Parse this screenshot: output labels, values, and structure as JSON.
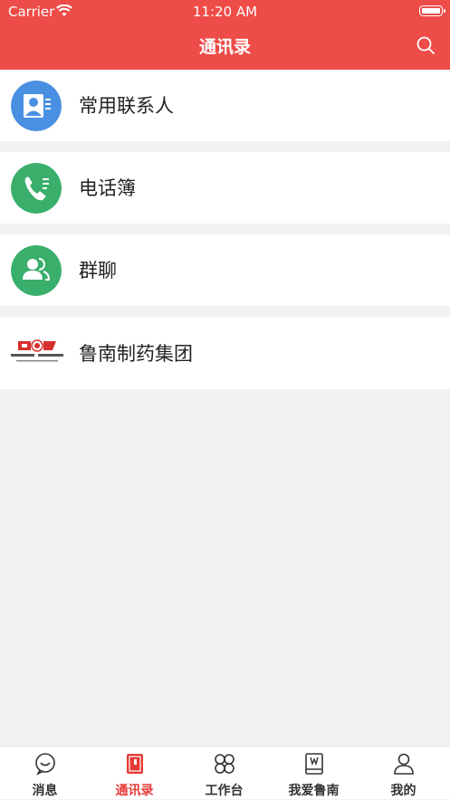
{
  "status_bar": {
    "carrier": "Carrier",
    "time": "11:20 AM"
  },
  "header": {
    "title": "通讯录"
  },
  "list": [
    {
      "label": "常用联系人",
      "icon": "frequent-contacts-icon",
      "color": "#4a90e2"
    },
    {
      "label": "电话簿",
      "icon": "phone-book-icon",
      "color": "#3aaf6b"
    },
    {
      "label": "群聊",
      "icon": "group-chat-icon",
      "color": "#3aaf6b"
    },
    {
      "label": "鲁南制药集团",
      "icon": "company-logo"
    }
  ],
  "tabs": [
    {
      "label": "消息",
      "icon": "message-icon"
    },
    {
      "label": "通讯录",
      "icon": "contacts-book-icon",
      "active": true
    },
    {
      "label": "工作台",
      "icon": "workbench-icon"
    },
    {
      "label": "我爱鲁南",
      "icon": "book-icon"
    },
    {
      "label": "我的",
      "icon": "profile-icon"
    }
  ],
  "colors": {
    "accent": "#ee4c48",
    "active_tab": "#e63a36"
  }
}
